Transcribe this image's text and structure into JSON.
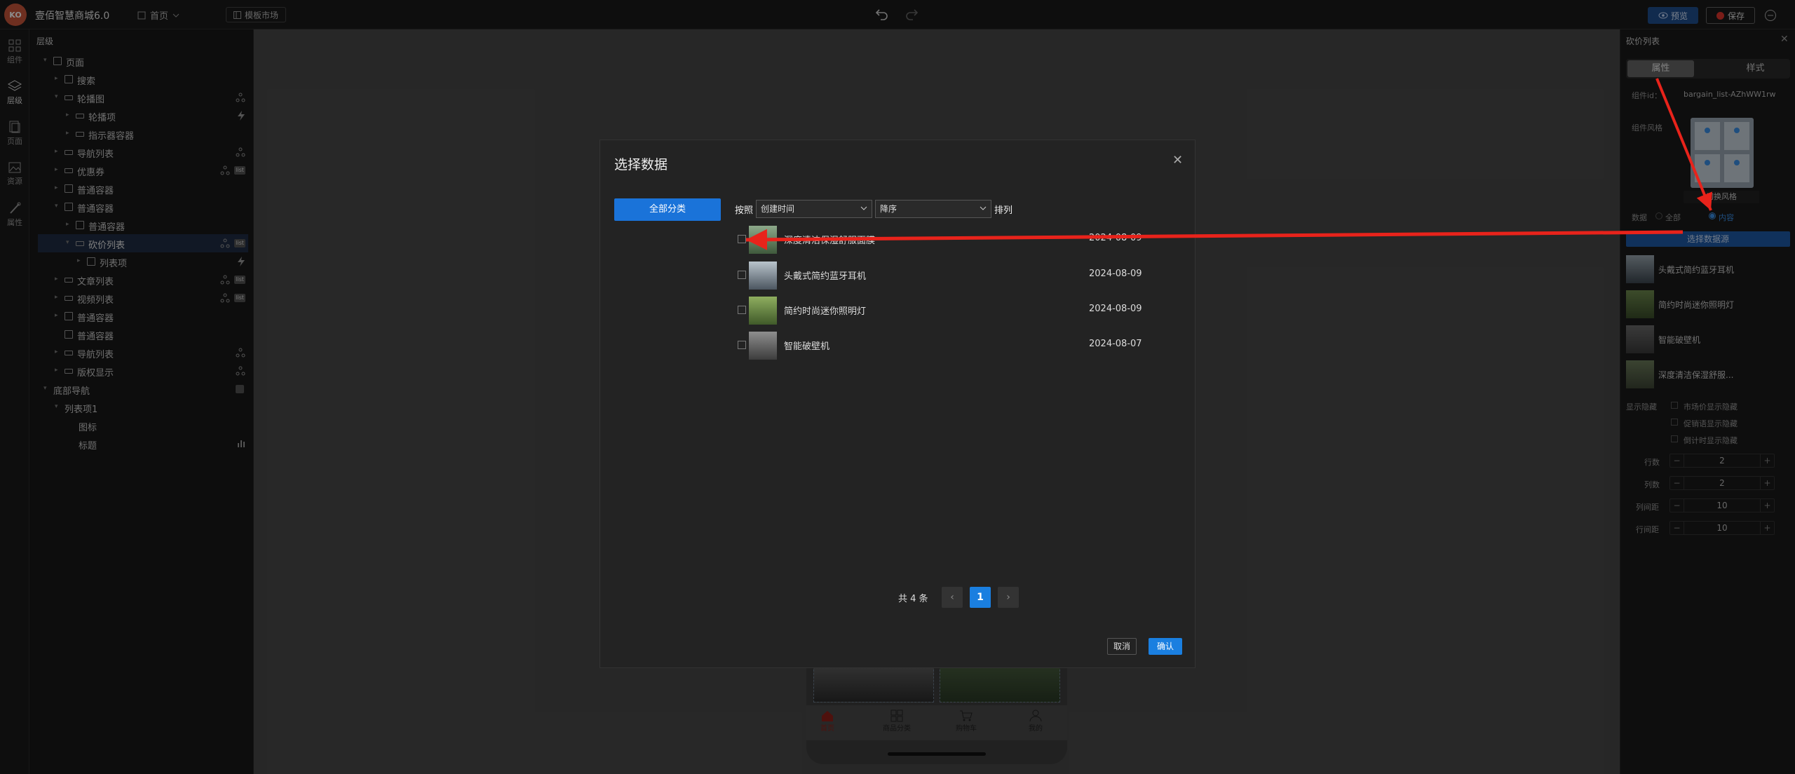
{
  "topbar": {
    "logo_text": "KO",
    "app_name": "壹佰智慧商城6.0",
    "page_select": "首页",
    "template_market": "模板市场",
    "preview": "预览",
    "save": "保存"
  },
  "rail": [
    {
      "label": "组件",
      "icon": "grid-icon"
    },
    {
      "label": "层级",
      "icon": "layers-icon"
    },
    {
      "label": "页面",
      "icon": "page-icon"
    },
    {
      "label": "资源",
      "icon": "image-icon"
    },
    {
      "label": "属性",
      "icon": "brush-icon"
    }
  ],
  "layers": {
    "title": "层级",
    "items": [
      {
        "label": "页面"
      },
      {
        "label": "搜索"
      },
      {
        "label": "轮播图"
      },
      {
        "label": "轮播项"
      },
      {
        "label": "指示器容器"
      },
      {
        "label": "导航列表"
      },
      {
        "label": "优惠券"
      },
      {
        "label": "普通容器"
      },
      {
        "label": "普通容器"
      },
      {
        "label": "普通容器"
      },
      {
        "label": "砍价列表"
      },
      {
        "label": "列表项"
      },
      {
        "label": "文章列表"
      },
      {
        "label": "视频列表"
      },
      {
        "label": "普通容器"
      },
      {
        "label": "普通容器"
      },
      {
        "label": "导航列表"
      },
      {
        "label": "版权显示"
      },
      {
        "label": "底部导航"
      },
      {
        "label": "列表项1"
      },
      {
        "label": "图标"
      },
      {
        "label": "标题"
      }
    ],
    "badge": "list"
  },
  "canvas": {
    "tabbar": [
      "首页",
      "商品分类",
      "购物车",
      "我的"
    ]
  },
  "right_panel": {
    "title": "砍价列表",
    "tabs": [
      "属性",
      "样式"
    ],
    "component_id_label": "组件id：",
    "component_id": "bargain_list-AZhWW1rw",
    "style_label": "组件风格",
    "switch_style": "切换风格",
    "data_label": "数据",
    "data_all": "全部",
    "data_content": "内容",
    "select_data_btn": "选择数据源",
    "items": [
      "头戴式简约蓝牙耳机",
      "简约时尚迷你照明灯",
      "智能破壁机",
      "深度清洁保湿舒服..."
    ],
    "show_hide_label": "显示隐藏",
    "show_hide_options": [
      "市场价显示隐藏",
      "促销语显示隐藏",
      "倒计时显示隐藏"
    ],
    "steppers": [
      {
        "label": "行数",
        "value": "2"
      },
      {
        "label": "列数",
        "value": "2"
      },
      {
        "label": "列间距",
        "value": "10"
      },
      {
        "label": "行间距",
        "value": "10"
      }
    ],
    "minus": "−",
    "plus": "+"
  },
  "modal": {
    "title": "选择数据",
    "all_categories": "全部分类",
    "sort_prefix": "按照",
    "sort_field": "创建时间",
    "sort_order": "降序",
    "sort_suffix": "排列",
    "rows": [
      {
        "name": "深度清洁保湿舒服面膜",
        "date": "2024-08-09"
      },
      {
        "name": "头戴式简约蓝牙耳机",
        "date": "2024-08-09"
      },
      {
        "name": "简约时尚迷你照明灯",
        "date": "2024-08-09"
      },
      {
        "name": "智能破壁机",
        "date": "2024-08-07"
      }
    ],
    "total": "共 4 条",
    "current_page": "1",
    "cancel": "取消",
    "confirm": "确认"
  },
  "colors": {
    "accent": "#1a7fe0",
    "annotation": "#e8231b"
  }
}
